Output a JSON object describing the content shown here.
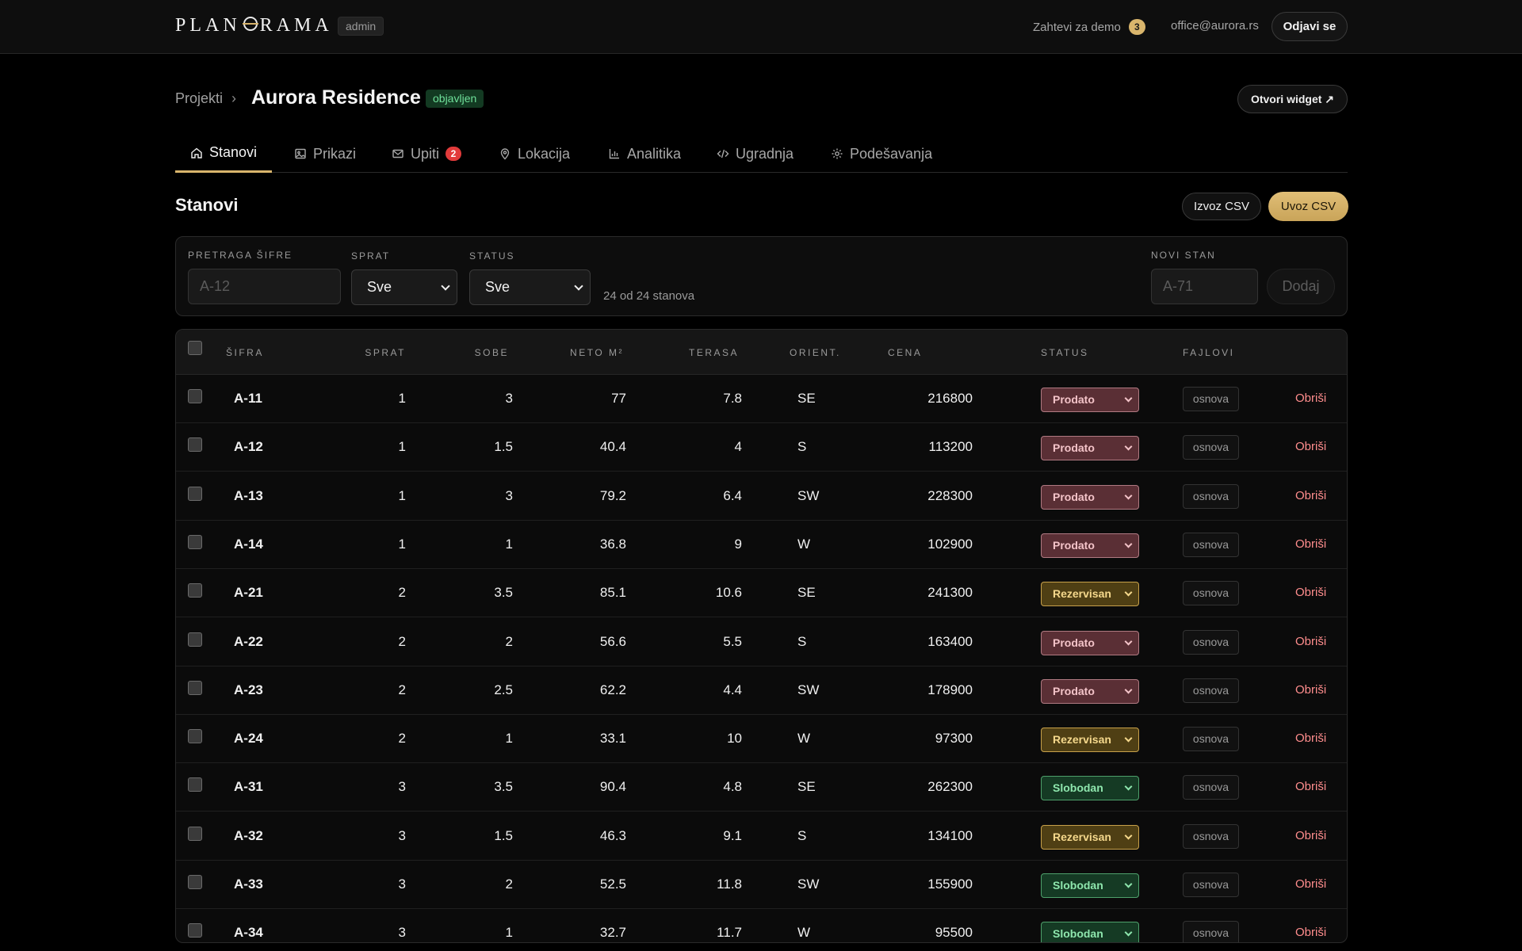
{
  "topbar": {
    "logo": "PLANORAMA",
    "role_badge": "admin",
    "demo_requests_label": "Zahtevi za demo",
    "demo_requests_count": "3",
    "user_email": "office@aurora.rs",
    "logout_label": "Odjavi se"
  },
  "header": {
    "breadcrumb_parent": "Projekti",
    "breadcrumb_sep": "›",
    "project_title": "Aurora Residence",
    "status_badge": "objavljen",
    "open_widget_label": "Otvori widget ↗"
  },
  "tabs": [
    {
      "label": "Stanovi",
      "icon": "home-icon",
      "active": true
    },
    {
      "label": "Prikazi",
      "icon": "image-icon"
    },
    {
      "label": "Upiti",
      "icon": "mail-icon",
      "count": "2"
    },
    {
      "label": "Lokacija",
      "icon": "map-pin-icon"
    },
    {
      "label": "Analitika",
      "icon": "bar-chart-icon"
    },
    {
      "label": "Ugradnja",
      "icon": "code-icon"
    },
    {
      "label": "Podešavanja",
      "icon": "gear-icon"
    }
  ],
  "section": {
    "title": "Stanovi",
    "export_label": "Izvoz CSV",
    "import_label": "Uvoz CSV"
  },
  "filters": {
    "search_label": "PRETRAGA ŠIFRE",
    "search_placeholder": "A-12",
    "floor_label": "SPRAT",
    "floor_value": "Sve",
    "status_label": "STATUS",
    "status_value": "Sve",
    "result_count": "24 od 24 stanova",
    "new_unit_label": "NOVI STAN",
    "new_unit_placeholder": "A-71",
    "add_label": "Dodaj"
  },
  "table": {
    "columns": [
      "ŠIFRA",
      "SPRAT",
      "SOBE",
      "NETO M²",
      "TERASA",
      "ORIENT.",
      "CENA",
      "STATUS",
      "FAJLOVI"
    ],
    "file_label": "osnova",
    "delete_label": "Obriši",
    "status_colors": {
      "Prodato": "#5a2f35",
      "Rezervisan": "#4f3f14",
      "Slobodan": "#153a24"
    },
    "rows": [
      {
        "code": "A-11",
        "floor": "1",
        "rooms": "3",
        "area": "77",
        "terrace": "7.8",
        "orient": "SE",
        "price": "216800",
        "status": "Prodato"
      },
      {
        "code": "A-12",
        "floor": "1",
        "rooms": "1.5",
        "area": "40.4",
        "terrace": "4",
        "orient": "S",
        "price": "113200",
        "status": "Prodato"
      },
      {
        "code": "A-13",
        "floor": "1",
        "rooms": "3",
        "area": "79.2",
        "terrace": "6.4",
        "orient": "SW",
        "price": "228300",
        "status": "Prodato"
      },
      {
        "code": "A-14",
        "floor": "1",
        "rooms": "1",
        "area": "36.8",
        "terrace": "9",
        "orient": "W",
        "price": "102900",
        "status": "Prodato"
      },
      {
        "code": "A-21",
        "floor": "2",
        "rooms": "3.5",
        "area": "85.1",
        "terrace": "10.6",
        "orient": "SE",
        "price": "241300",
        "status": "Rezervisan"
      },
      {
        "code": "A-22",
        "floor": "2",
        "rooms": "2",
        "area": "56.6",
        "terrace": "5.5",
        "orient": "S",
        "price": "163400",
        "status": "Prodato"
      },
      {
        "code": "A-23",
        "floor": "2",
        "rooms": "2.5",
        "area": "62.2",
        "terrace": "4.4",
        "orient": "SW",
        "price": "178900",
        "status": "Prodato"
      },
      {
        "code": "A-24",
        "floor": "2",
        "rooms": "1",
        "area": "33.1",
        "terrace": "10",
        "orient": "W",
        "price": "97300",
        "status": "Rezervisan"
      },
      {
        "code": "A-31",
        "floor": "3",
        "rooms": "3.5",
        "area": "90.4",
        "terrace": "4.8",
        "orient": "SE",
        "price": "262300",
        "status": "Slobodan"
      },
      {
        "code": "A-32",
        "floor": "3",
        "rooms": "1.5",
        "area": "46.3",
        "terrace": "9.1",
        "orient": "S",
        "price": "134100",
        "status": "Rezervisan"
      },
      {
        "code": "A-33",
        "floor": "3",
        "rooms": "2",
        "area": "52.5",
        "terrace": "11.8",
        "orient": "SW",
        "price": "155900",
        "status": "Slobodan"
      },
      {
        "code": "A-34",
        "floor": "3",
        "rooms": "1",
        "area": "32.7",
        "terrace": "11.7",
        "orient": "W",
        "price": "95500",
        "status": "Slobodan"
      }
    ]
  }
}
